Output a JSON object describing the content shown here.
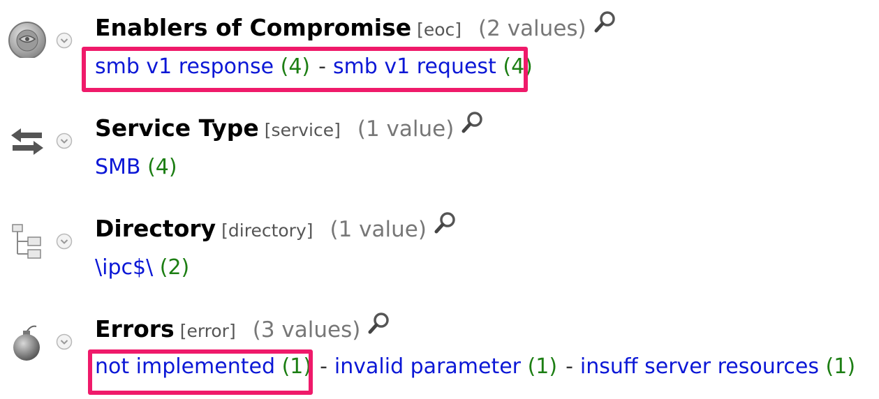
{
  "sections": [
    {
      "title": "Enablers of Compromise",
      "key": "[eoc]",
      "count": "(2 values)",
      "icon": "eoc-icon",
      "values": [
        {
          "label": "smb v1 response",
          "count": "(4)"
        },
        {
          "label": "smb v1 request",
          "count": "(4)"
        }
      ]
    },
    {
      "title": "Service Type",
      "key": "[service]",
      "count": "(1 value)",
      "icon": "arrows-icon",
      "values": [
        {
          "label": "SMB",
          "count": "(4)"
        }
      ]
    },
    {
      "title": "Directory",
      "key": "[directory]",
      "count": "(1 value)",
      "icon": "directory-tree-icon",
      "values": [
        {
          "label": "\\ipc$\\",
          "count": "(2)"
        }
      ]
    },
    {
      "title": "Errors",
      "key": "[error]",
      "count": "(3 values)",
      "icon": "bomb-icon",
      "values": [
        {
          "label": "not implemented",
          "count": "(1)"
        },
        {
          "label": "invalid parameter",
          "count": "(1)"
        },
        {
          "label": "insuff server resources",
          "count": "(1)"
        }
      ]
    }
  ],
  "separator": "-",
  "highlight_color": "#ef1a6a"
}
